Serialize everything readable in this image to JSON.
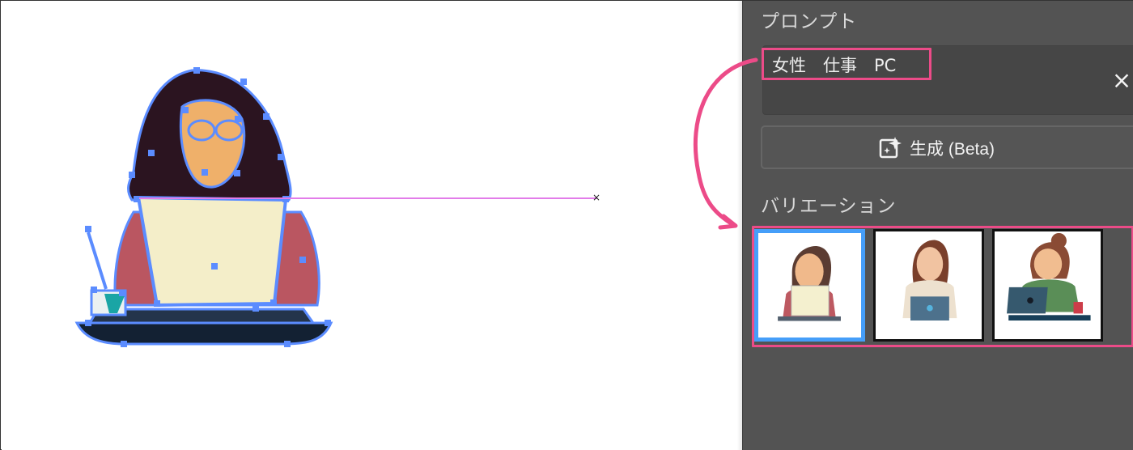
{
  "prompt_panel": {
    "title": "プロンプト",
    "prompt_text": "女性　仕事　PC",
    "clear_icon": "close-icon",
    "generate_label": "生成 (Beta)",
    "generate_icon": "sparkle-generate-icon"
  },
  "variations": {
    "title": "バリエーション",
    "selected_index": 0,
    "items": [
      {
        "name": "variation-1",
        "hair": "#5b3c32",
        "laptop": "#f4f0cf",
        "top": "#bd5961"
      },
      {
        "name": "variation-2",
        "hair": "#7a3f2b",
        "laptop": "#4d718c",
        "top": "#ede1cf"
      },
      {
        "name": "variation-3",
        "hair": "#8a4b34",
        "laptop": "#36596e",
        "top": "#5a8e57"
      }
    ]
  },
  "colors": {
    "panel_background": "#535353",
    "selection_blue": "#459ef9",
    "annotation_pink": "#ec4b88",
    "anchor_blue": "#5b8cff",
    "guide_magenta": "#e27ce9"
  }
}
